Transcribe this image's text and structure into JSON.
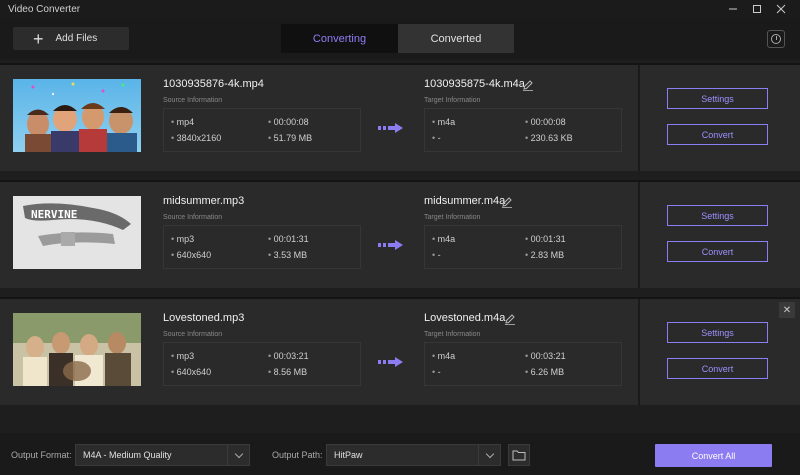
{
  "window": {
    "title": "Video Converter",
    "minimize_icon": "minimize-icon",
    "maximize_icon": "maximize-icon",
    "close_icon": "close-icon"
  },
  "toolbar": {
    "add_files_label": "Add Files",
    "tabs": [
      {
        "label": "Converting",
        "active": true
      },
      {
        "label": "Converted",
        "active": false
      }
    ],
    "history_icon": "clock-icon"
  },
  "labels": {
    "source_info": "Source Information",
    "target_info": "Target Information",
    "settings": "Settings",
    "convert": "Convert"
  },
  "items": [
    {
      "source_name": "1030935876-4k.mp4",
      "source": {
        "format": "mp4",
        "duration": "00:00:08",
        "resolution": "3840x2160",
        "size": "51.79 MB"
      },
      "target_name": "1030935875-4k.m4a",
      "target": {
        "format": "m4a",
        "duration": "00:00:08",
        "resolution": "-",
        "size": "230.63 KB"
      }
    },
    {
      "source_name": "midsummer.mp3",
      "source": {
        "format": "mp3",
        "duration": "00:01:31",
        "resolution": "640x640",
        "size": "3.53 MB"
      },
      "target_name": "midsummer.m4a",
      "target": {
        "format": "m4a",
        "duration": "00:01:31",
        "resolution": "-",
        "size": "2.83 MB"
      }
    },
    {
      "source_name": "Lovestoned.mp3",
      "source": {
        "format": "mp3",
        "duration": "00:03:21",
        "resolution": "640x640",
        "size": "8.56 MB"
      },
      "target_name": "Lovestoned.m4a",
      "target": {
        "format": "m4a",
        "duration": "00:03:21",
        "resolution": "-",
        "size": "6.26 MB"
      }
    }
  ],
  "thumb_text": "NERVINE",
  "footer": {
    "output_format_label": "Output Format:",
    "output_format_value": "M4A - Medium Quality",
    "output_path_label": "Output Path:",
    "output_path_value": "HitPaw",
    "convert_all_label": "Convert All"
  },
  "colors": {
    "accent": "#8b7cf1",
    "background": "#161616",
    "panel": "#2a2a2a"
  }
}
